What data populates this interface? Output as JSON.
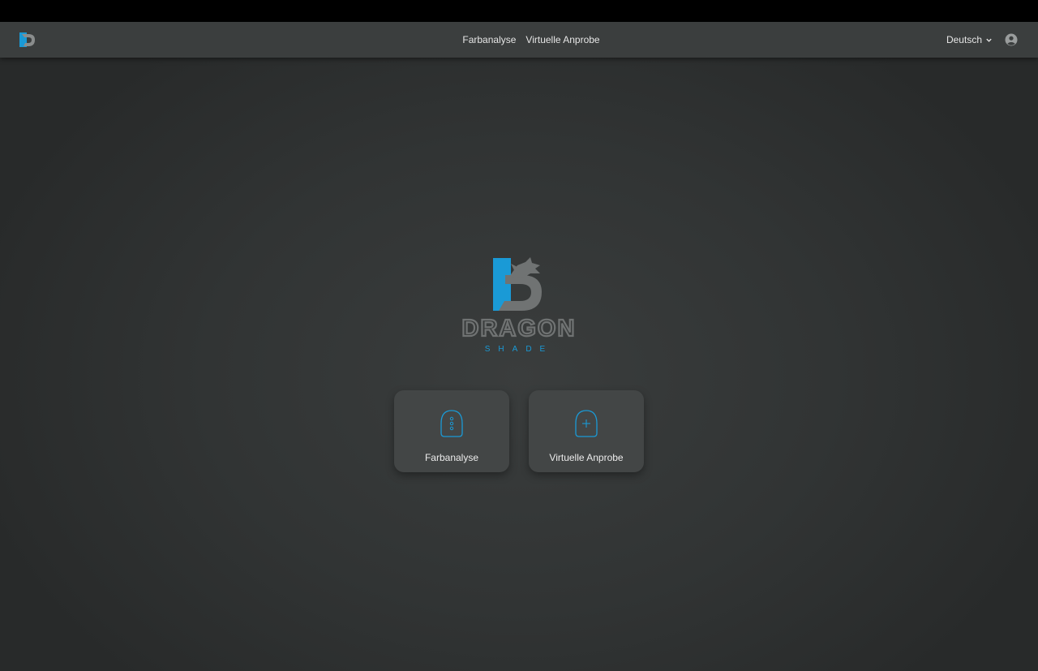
{
  "nav": {
    "links": [
      "Farbanalyse",
      "Virtuelle Anprobe"
    ],
    "language": "Deutsch"
  },
  "brand": {
    "name": "DRAGON",
    "tagline": "SHADE"
  },
  "cards": [
    {
      "label": "Farbanalyse",
      "icon": "scanner-dots-icon"
    },
    {
      "label": "Virtuelle Anprobe",
      "icon": "scanner-plus-icon"
    }
  ],
  "colors": {
    "accent": "#1a9ad6",
    "logo_gray": "#707373",
    "navbar": "#3b3e3e",
    "card": "#434646"
  }
}
